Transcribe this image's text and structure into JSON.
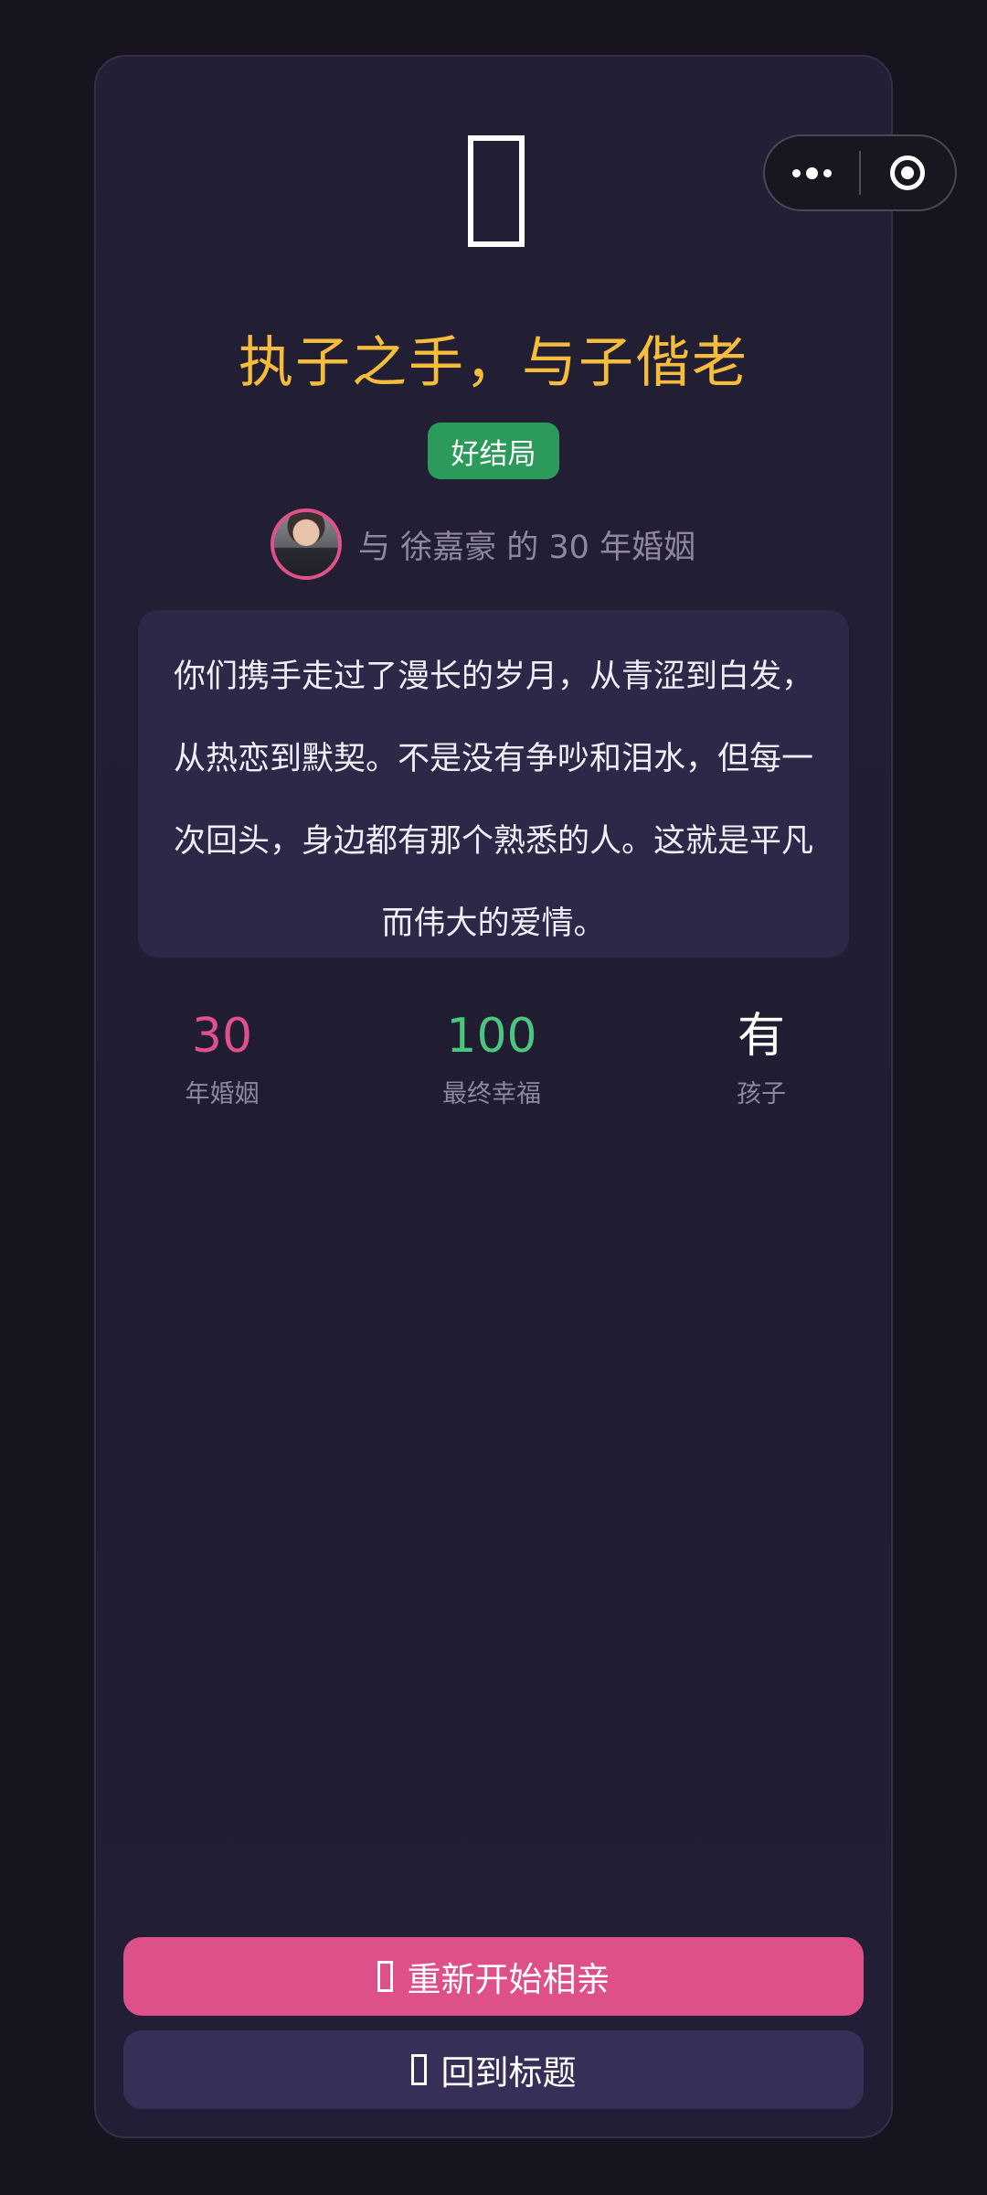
{
  "result": {
    "title": "执子之手，与子偕老",
    "badge": "好结局",
    "partner_line": "与 徐嘉豪 的 30 年婚姻",
    "story": "你们携手走过了漫长的岁月，从青涩到白发，从热恋到默契。不是没有争吵和泪水，但每一次回头，身边都有那个熟悉的人。这就是平凡而伟大的爱情。"
  },
  "stats": [
    {
      "value": "30",
      "label": "年婚姻",
      "color": "#e0508a"
    },
    {
      "value": "100",
      "label": "最终幸福",
      "color": "#4cc67e"
    },
    {
      "value": "有",
      "label": "孩子",
      "color": "#ffffff"
    }
  ],
  "buttons": {
    "restart": "重新开始相亲",
    "back_to_title": "回到标题"
  },
  "colors": {
    "title": "#f5bd3b",
    "badge_bg": "#2b9a5a",
    "restart_bg": "#dd508a",
    "secondary_bg": "#372f57"
  },
  "icons": {
    "capsule_menu": "more-dots-icon",
    "capsule_close": "target-icon",
    "result_emoji": "missing-glyph-icon"
  }
}
